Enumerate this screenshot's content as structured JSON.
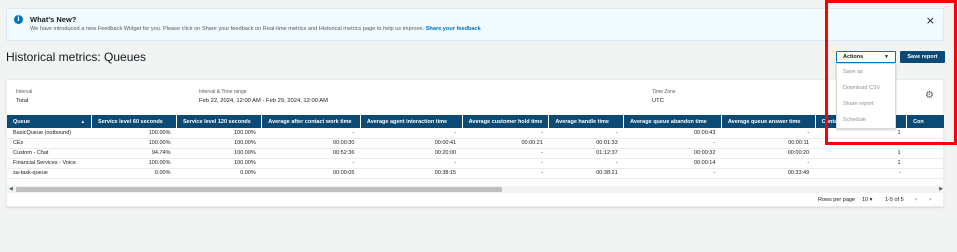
{
  "banner": {
    "icon": "info-icon",
    "title": "What's New?",
    "text": "We have introduced a new Feedback Widget for you. Please click on Share your feedback on Real-time metrics and Historical metrics page to help us improve.",
    "link": "Share your feedback",
    "close": "×"
  },
  "header": {
    "title": "Historical metrics: Queues",
    "actions_label": "Actions",
    "save_label": "Save report"
  },
  "actions_menu": {
    "items": [
      "Save as",
      "Download CSV",
      "Share report",
      "Schedule"
    ]
  },
  "filters": {
    "interval_label": "Interval",
    "interval_value": "Total",
    "range_label": "Interval & Time range",
    "range_value": "Feb 22, 2024, 12:00 AM - Feb 29, 2024, 12:00 AM",
    "tz_label": "Time Zone",
    "tz_value": "UTC"
  },
  "table": {
    "columns": [
      "Queue",
      "Service level 60 seconds",
      "Service level 120 seconds",
      "Average after contact work time",
      "Average agent interaction time",
      "Average customer hold time",
      "Average handle time",
      "Average queue abandon time",
      "Average queue answer time",
      "Contacts abandoned",
      "Con"
    ],
    "rows": [
      [
        "BasicQueue (outbound)",
        "100.00%",
        "100.00%",
        "-",
        "-",
        "-",
        "-",
        "00:00:43",
        "-",
        "1",
        ""
      ],
      [
        "CEx",
        "100.00%",
        "100.00%",
        "00:00:30",
        "00:00:41",
        "00:00:21",
        "00:01:33",
        "-",
        "00:00:11",
        "-",
        ""
      ],
      [
        "Custom - Chat",
        "94.74%",
        "100.00%",
        "00:52:36",
        "00:20:00",
        "-",
        "01:12:37",
        "00:00:32",
        "00:00:20",
        "1",
        ""
      ],
      [
        "Financial Services - Voice",
        "100.00%",
        "100.00%",
        "-",
        "-",
        "-",
        "-",
        "00:00:14",
        "-",
        "1",
        ""
      ],
      [
        "sa-task-queue",
        "0.00%",
        "0.00%",
        "00:00:05",
        "00:38:15",
        "-",
        "00:38:21",
        "-",
        "00:33:49",
        "-",
        ""
      ]
    ]
  },
  "pagination": {
    "rows_per_page_label": "Rows per page",
    "rows_per_page_value": "10",
    "range": "1-5 of 5"
  }
}
